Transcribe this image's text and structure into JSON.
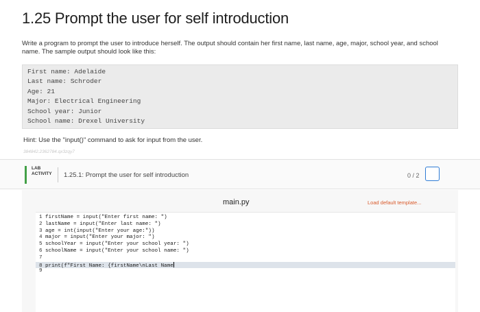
{
  "page": {
    "title": "1.25 Prompt the user for self introduction",
    "intro": "Write a program to prompt the user to introduce herself. The output should contain her first name, last name, age, major, school year, and school name. The sample output should look like this:",
    "sample_output": [
      "First name: Adelaide",
      "Last name: Schroder",
      "Age: 21",
      "Major: Electrical Engineering",
      "School year: Junior",
      "School name: Drexel University"
    ],
    "hint": "Hint: Use the \"input()\" command to ask for input from the user.",
    "faint_id": "384842.2362784.qx3zqy7"
  },
  "lab": {
    "badge_line1": "LAB",
    "badge_line2": "ACTIVITY",
    "title": "1.25.1: Prompt the user for self introduction",
    "score": "0 / 2"
  },
  "editor": {
    "file_name": "main.py",
    "load_template_label": "Load default template...",
    "lines": [
      {
        "num": "1",
        "code": "firstName = input(\"Enter first name: \")"
      },
      {
        "num": "2",
        "code": "lastName = input(\"Enter last name: \")"
      },
      {
        "num": "3",
        "code": "age = int(input(\"Enter your age:\"))"
      },
      {
        "num": "4",
        "code": "major = input(\"Enter your major: \")"
      },
      {
        "num": "5",
        "code": "schoolYear = input(\"Enter your school year: \")"
      },
      {
        "num": "6",
        "code": "schoolName = input(\"Enter your school name: \")"
      },
      {
        "num": "7",
        "code": ""
      },
      {
        "num": "8",
        "code": "print(f\"First Name: {firstName\\nLast Name"
      },
      {
        "num": "9",
        "code": ""
      }
    ],
    "active_line": 8
  }
}
